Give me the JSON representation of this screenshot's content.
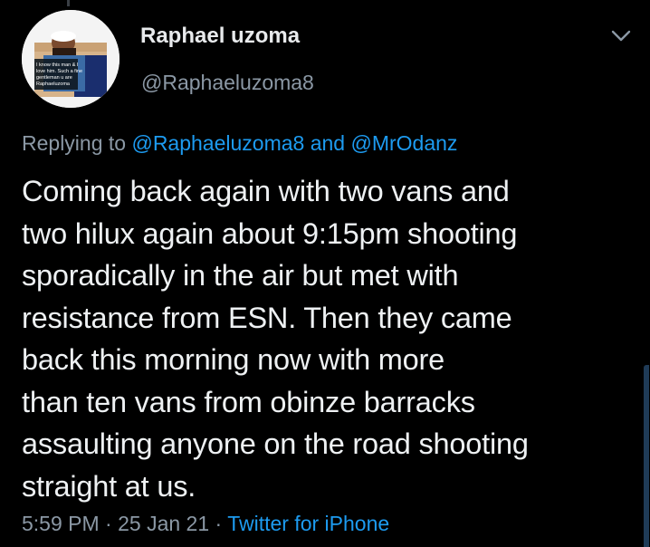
{
  "tweet": {
    "author": {
      "display_name": "Raphael uzoma",
      "handle": "@Raphaeluzoma8",
      "avatar_caption": "I know this man & I love him. Such a fine gentleman u are Raphaeluzoma"
    },
    "replying_to": {
      "prefix": "Replying to",
      "mention_1": "@Raphaeluzoma8",
      "connector": "and",
      "mention_2": "@MrOdanz"
    },
    "text_lines": [
      "Coming back again with two vans and",
      "two hilux again about 9:15pm shooting",
      "sporadically in the air but met with",
      "resistance from ESN. Then they came",
      "back this morning now with more",
      "than ten vans from obinze barracks",
      "assaulting anyone on the road shooting",
      "straight at us."
    ],
    "time": "5:59 PM",
    "date": "25 Jan 21",
    "separator": "·",
    "source": "Twitter for iPhone",
    "menu_icon": "chevron-down-icon"
  },
  "colors": {
    "background": "#000000",
    "primary_text": "#e8eaec",
    "secondary_text": "#8b98a5",
    "link": "#1d9bf0"
  }
}
